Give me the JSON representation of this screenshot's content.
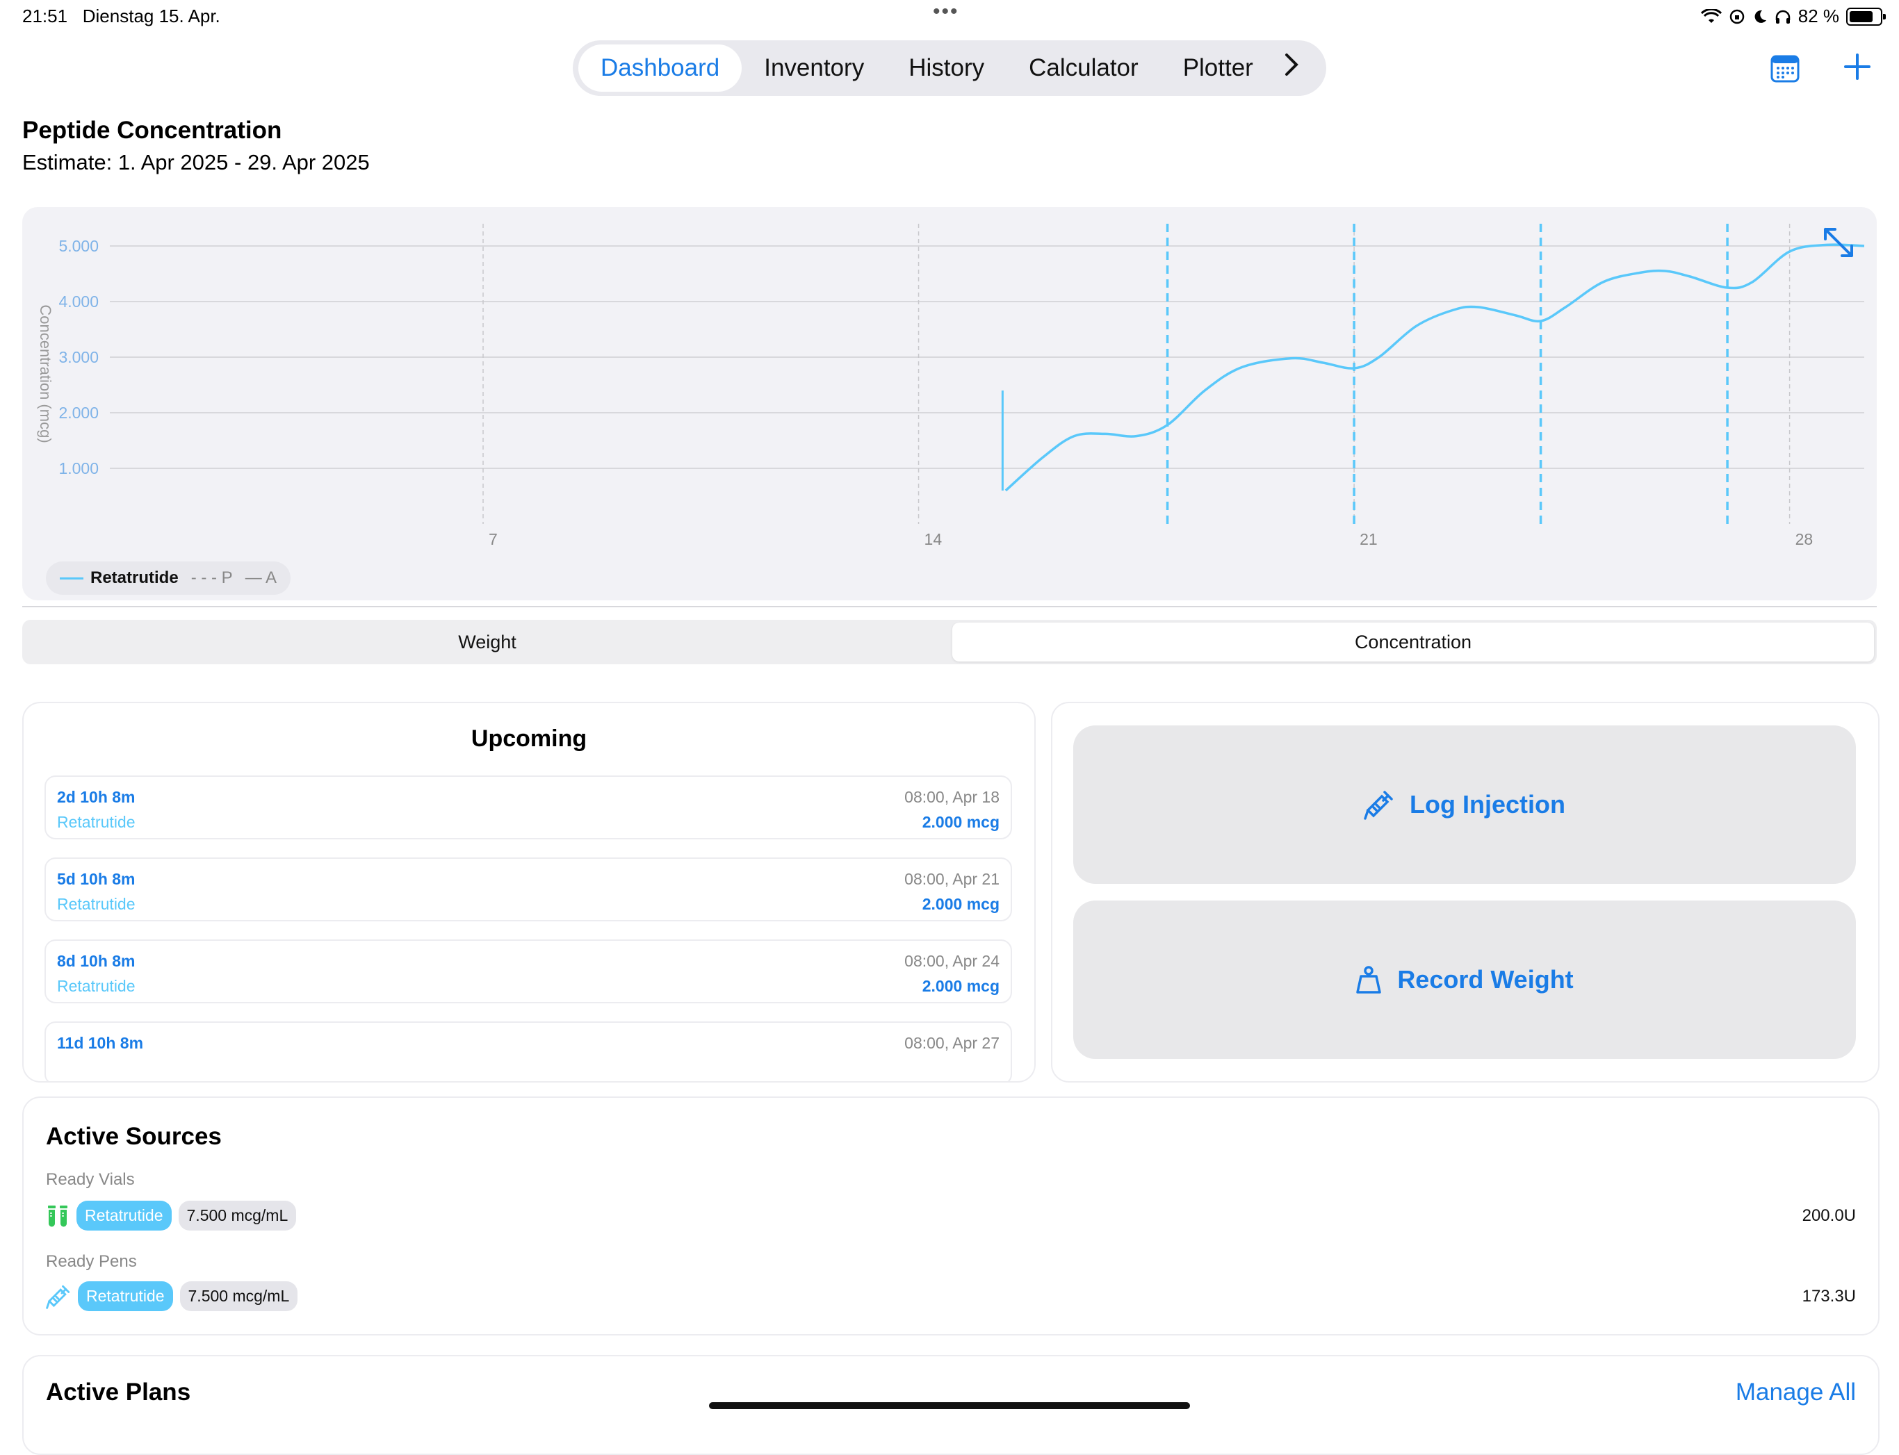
{
  "status": {
    "time": "21:51",
    "date": "Dienstag 15. Apr.",
    "battery": "82 %",
    "battery_level": 0.82
  },
  "tabs": [
    {
      "label": "Dashboard",
      "active": true
    },
    {
      "label": "Inventory"
    },
    {
      "label": "History"
    },
    {
      "label": "Calculator"
    },
    {
      "label": "Plotter"
    }
  ],
  "header": {
    "title": "Peptide Concentration",
    "subtitle": "Estimate: 1. Apr 2025 - 29. Apr 2025"
  },
  "chart_data": {
    "type": "line",
    "title": "Peptide Concentration",
    "ylabel": "Concentration (mcg)",
    "xlabel": "",
    "xlim": [
      1,
      29.2
    ],
    "ylim": [
      0,
      5400
    ],
    "x_ticks": [
      7,
      14,
      21,
      28
    ],
    "y_ticks": [
      1000,
      2000,
      3000,
      4000,
      5000
    ],
    "y_tick_labels": [
      "1.000",
      "2.000",
      "3.000",
      "4.000",
      "5.000"
    ],
    "grid": true,
    "legend_position": "bottom-left",
    "series": [
      {
        "name": "Retatrutide",
        "color": "#5ac8fa",
        "points": [
          [
            15.4,
            600
          ],
          [
            16,
            1200
          ],
          [
            16.5,
            1580
          ],
          [
            17,
            1620
          ],
          [
            17.5,
            1580
          ],
          [
            18,
            1780
          ],
          [
            18.6,
            2400
          ],
          [
            19.2,
            2820
          ],
          [
            20,
            2980
          ],
          [
            20.5,
            2900
          ],
          [
            21,
            2800
          ],
          [
            21.4,
            3000
          ],
          [
            22,
            3560
          ],
          [
            22.6,
            3850
          ],
          [
            23,
            3900
          ],
          [
            23.6,
            3750
          ],
          [
            24,
            3650
          ],
          [
            24.4,
            3900
          ],
          [
            25,
            4350
          ],
          [
            25.6,
            4520
          ],
          [
            26,
            4550
          ],
          [
            26.4,
            4450
          ],
          [
            27,
            4250
          ],
          [
            27.4,
            4350
          ],
          [
            28,
            4900
          ],
          [
            28.6,
            5020
          ],
          [
            29.2,
            5000
          ]
        ]
      }
    ],
    "vertical_markers": [
      {
        "x": 15.35,
        "from": 600,
        "to": 2400,
        "style": "solid"
      }
    ],
    "injection_markers": [
      18,
      21,
      24,
      27
    ],
    "legend": [
      {
        "label": "Retatrutide",
        "style": "solid",
        "color": "#5ac8fa"
      },
      {
        "label": "P",
        "style": "dashed",
        "color": "#999999"
      },
      {
        "label": "A",
        "style": "solid",
        "color": "#999999"
      }
    ]
  },
  "segmented": {
    "left": "Weight",
    "right": "Concentration",
    "selected": "Concentration"
  },
  "upcoming": {
    "title": "Upcoming",
    "items": [
      {
        "time": "2d 10h 8m",
        "name": "Retatrutide",
        "date": "08:00, Apr 18",
        "dose": "2.000 mcg"
      },
      {
        "time": "5d 10h 8m",
        "name": "Retatrutide",
        "date": "08:00, Apr 21",
        "dose": "2.000 mcg"
      },
      {
        "time": "8d 10h 8m",
        "name": "Retatrutide",
        "date": "08:00, Apr 24",
        "dose": "2.000 mcg"
      },
      {
        "time": "11d 10h 8m",
        "name": "",
        "date": "08:00, Apr 27",
        "dose": ""
      }
    ]
  },
  "actions": {
    "log": "Log Injection",
    "record": "Record Weight"
  },
  "sources": {
    "title": "Active Sources",
    "vials_label": "Ready Vials",
    "pens_label": "Ready Pens",
    "vial": {
      "name": "Retatrutide",
      "conc": "7.500 mcg/mL",
      "amount": "200.0U"
    },
    "pen": {
      "name": "Retatrutide",
      "conc": "7.500 mcg/mL",
      "amount": "173.3U"
    }
  },
  "plans": {
    "title": "Active Plans",
    "manage": "Manage All"
  },
  "colors": {
    "accent": "#1a7ce6",
    "series": "#5ac8fa",
    "vial_icon": "#34c759"
  },
  "icons": [
    "calendar-icon",
    "plus-icon",
    "expand-icon",
    "syringe-icon",
    "weight-icon",
    "vial-icon",
    "pen-icon",
    "chevron-right-icon"
  ]
}
